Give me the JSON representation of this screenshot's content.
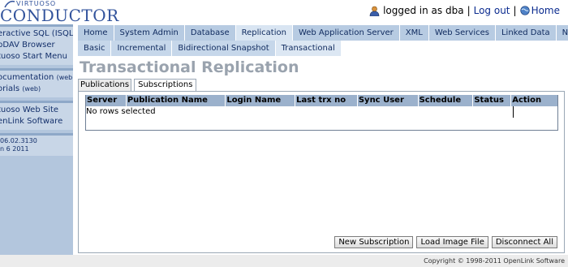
{
  "header": {
    "logo_small": "VIRTUOSO",
    "logo_big": "CONDUCTOR",
    "logged_in": "logged in as dba",
    "separator": "|",
    "logout": "Log out",
    "home": "Home"
  },
  "sidebar": {
    "group1": [
      "eractive SQL (ISQL)",
      "bDAV Browser",
      "tuoso Start Menu"
    ],
    "group2": [
      {
        "label": "ocumentation ",
        "suffix": "(web)"
      },
      {
        "label": "orials ",
        "suffix": "(web)"
      }
    ],
    "group3": [
      "tuoso Web Site",
      "enLink Software"
    ],
    "info": [
      " 06.02.3130",
      "n 6 2011"
    ]
  },
  "nav1": [
    {
      "label": "Home",
      "active": false
    },
    {
      "label": "System Admin",
      "active": false
    },
    {
      "label": "Database",
      "active": false
    },
    {
      "label": "Replication",
      "active": true
    },
    {
      "label": "Web Application Server",
      "active": false
    },
    {
      "label": "XML",
      "active": false
    },
    {
      "label": "Web Services",
      "active": false
    },
    {
      "label": "Linked Data",
      "active": false
    },
    {
      "label": "NNTP",
      "active": false
    }
  ],
  "nav2": [
    {
      "label": "Basic",
      "active": false
    },
    {
      "label": "Incremental",
      "active": false
    },
    {
      "label": "Bidirectional Snapshot",
      "active": false
    },
    {
      "label": "Transactional",
      "active": true
    }
  ],
  "page_title": "Transactional Replication",
  "subtabs": [
    {
      "label": "Publications",
      "active": false
    },
    {
      "label": "Subscriptions",
      "active": true
    }
  ],
  "grid": {
    "columns": [
      "Server",
      "Publication Name",
      "Login Name",
      "Last trx no",
      "Sync User",
      "Schedule",
      "Status",
      "Action"
    ],
    "empty_message": "No rows selected"
  },
  "buttons": {
    "new_subscription": "New Subscription",
    "load_image": "Load Image File",
    "disconnect_all": "Disconnect All"
  },
  "footer": "Copyright © 1998-2011 OpenLink Software",
  "colors": {
    "brand": "#32539c",
    "sidebar": "#b3c6dd",
    "tab": "#b7cbe2",
    "grid_header": "#9bb1cc"
  }
}
